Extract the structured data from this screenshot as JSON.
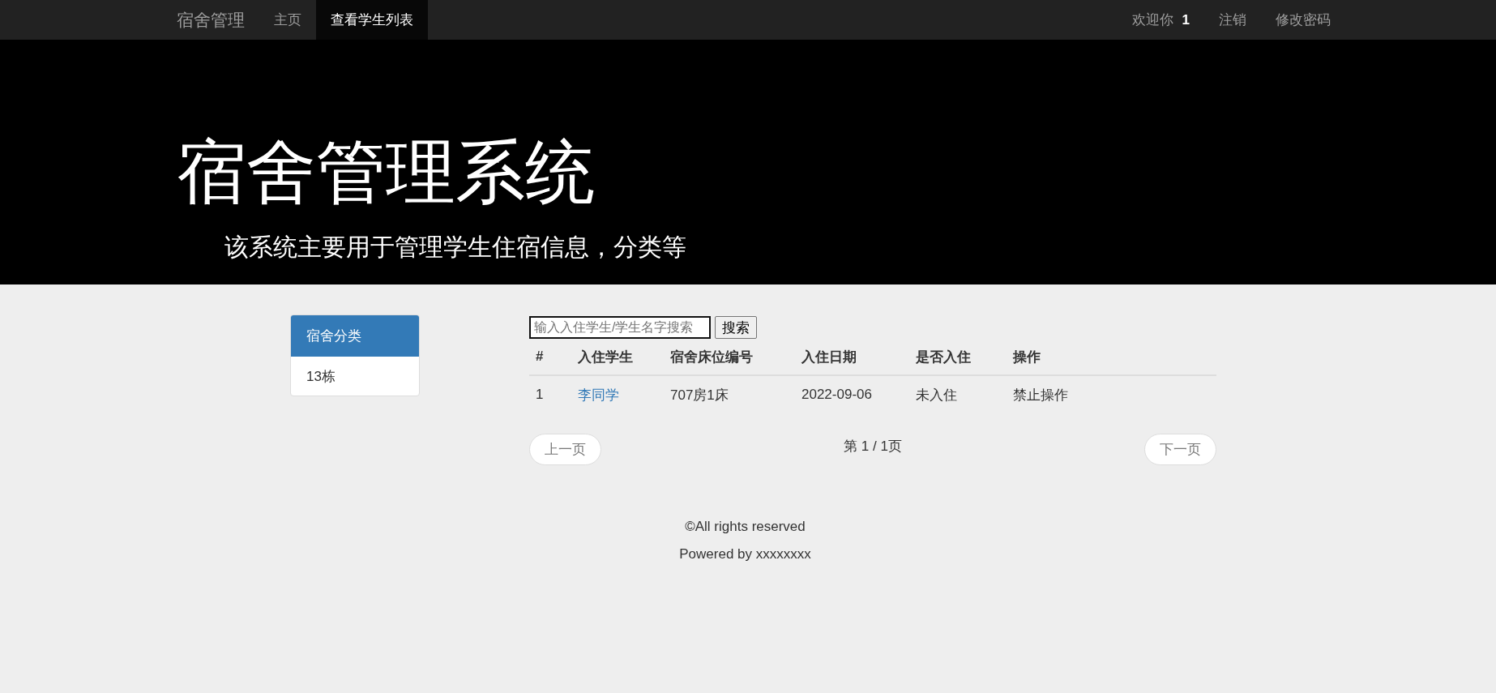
{
  "navbar": {
    "brand": "宿舍管理",
    "tabs": [
      {
        "label": "主页",
        "selected": false
      },
      {
        "label": "查看学生列表",
        "selected": true
      }
    ],
    "welcome": "欢迎你 **1**",
    "links": [
      "注销",
      "修改密码"
    ]
  },
  "jumbotron": {
    "title": "宿舍管理系统",
    "subtitle": "该系统主要用于管理学生住宿信息，分类等"
  },
  "sidebar": {
    "heading": "宿舍分类",
    "items": [
      "13栋"
    ]
  },
  "search": {
    "placeholder": "输入入住学生/学生名字搜索",
    "button": "搜索"
  },
  "table": {
    "columns": [
      "#",
      "入住学生",
      "宿舍床位编号",
      "入住日期",
      "是否入住",
      "操作"
    ],
    "rows": [
      [
        "1",
        "李同学",
        "707房1床",
        "2022-09-06",
        "未入住",
        "禁止操作"
      ]
    ]
  },
  "pagination": {
    "previous": "上一页",
    "status": "第 1 / 1页",
    "next": "下一页"
  },
  "footer": [
    "©All rights reserved",
    "Powered by xxxxxxxx"
  ]
}
